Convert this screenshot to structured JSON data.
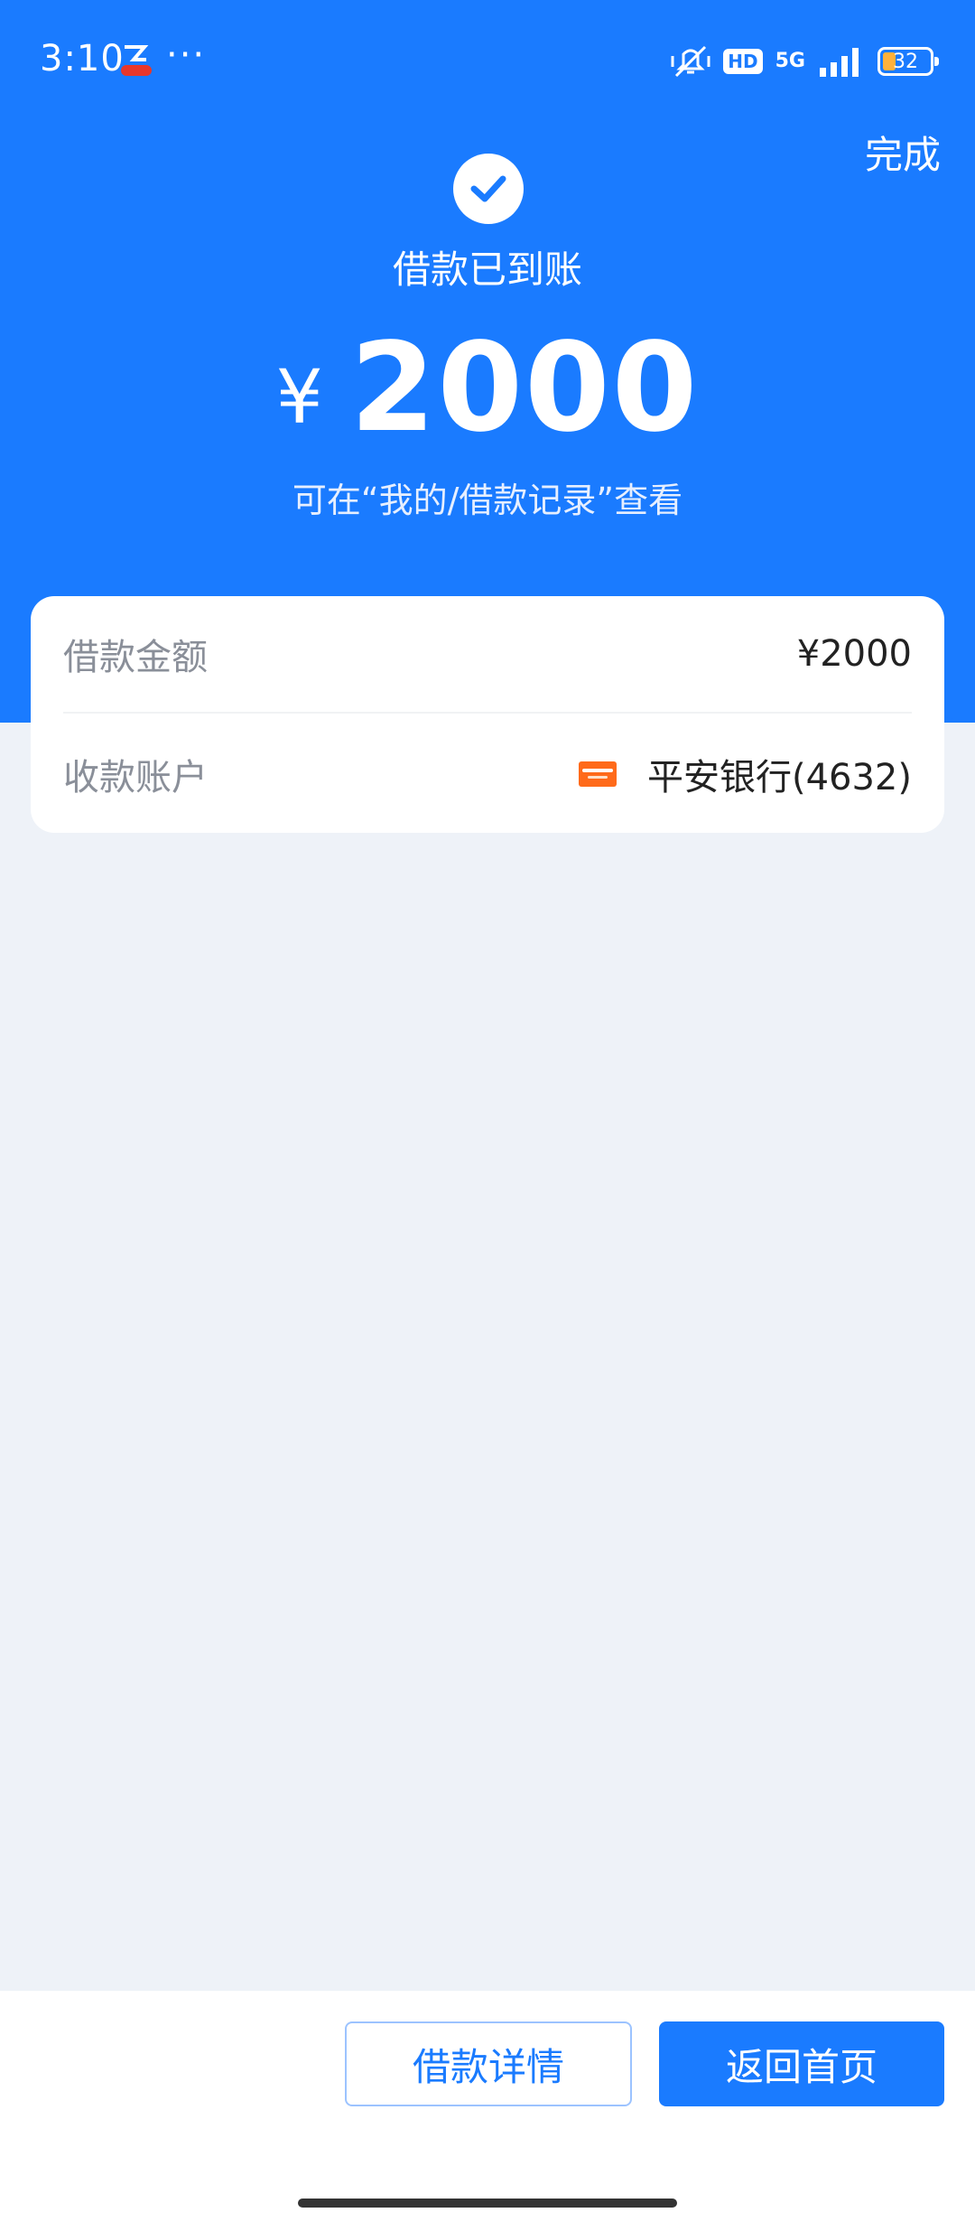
{
  "status_bar": {
    "time": "3:10",
    "dots": "···",
    "hd": "HD",
    "network": "5G",
    "battery": "32"
  },
  "header": {
    "done_label": "完成",
    "title": "借款已到账",
    "currency": "¥",
    "amount": "2000",
    "hint": "可在“我的/借款记录”查看"
  },
  "card": {
    "rows": [
      {
        "label": "借款金额",
        "value": "¥2000"
      },
      {
        "label": "收款账户",
        "value": "平安银行(4632)"
      }
    ]
  },
  "actions": {
    "detail_label": "借款详情",
    "home_label": "返回首页"
  },
  "colors": {
    "primary": "#1a7bff",
    "background": "#eef2f8",
    "bank_logo": "#ff6a1a"
  },
  "icons": {
    "success": "check-circle-icon",
    "bank": "ping-an-bank-logo-icon"
  }
}
